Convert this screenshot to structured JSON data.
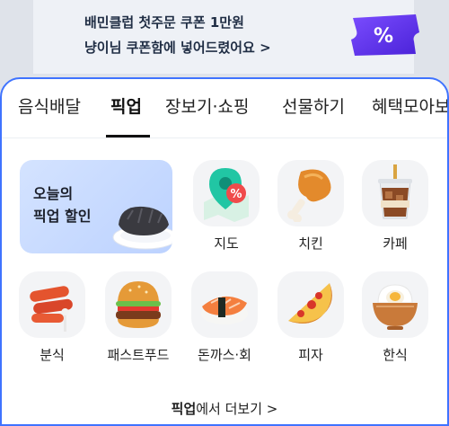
{
  "banner": {
    "line1": "배민클럽 첫주문 쿠폰 1만원",
    "line2": "냥이님 쿠폰함에 넣어드렸어요 >",
    "coupon_icon": "percent-ticket-icon",
    "accent": "#5a2de6"
  },
  "tabs": [
    {
      "label": "음식배달",
      "active": false
    },
    {
      "label": "픽업",
      "active": true
    },
    {
      "label": "장보기·쇼핑",
      "active": false
    },
    {
      "label": "선물하기",
      "active": false
    },
    {
      "label": "혜택모아보기",
      "active": false
    }
  ],
  "promo": {
    "line1": "오늘의",
    "line2": "픽업 할인",
    "image": "bread-on-plate"
  },
  "categories_row1": [
    {
      "label": "지도",
      "icon": "map-pin-icon"
    },
    {
      "label": "치킨",
      "icon": "chicken-icon"
    },
    {
      "label": "카페",
      "icon": "iced-drink-icon"
    }
  ],
  "categories_row2": [
    {
      "label": "분식",
      "icon": "tteokbokki-icon"
    },
    {
      "label": "패스트푸드",
      "icon": "burger-icon"
    },
    {
      "label": "돈까스·회",
      "icon": "sushi-icon"
    },
    {
      "label": "피자",
      "icon": "pizza-icon"
    },
    {
      "label": "한식",
      "icon": "rice-bowl-icon"
    }
  ],
  "more": {
    "bold": "픽업",
    "rest": "에서 더보기  >"
  },
  "colors": {
    "card_border": "#3f73ff",
    "promo_bg": "#c8dbff"
  }
}
